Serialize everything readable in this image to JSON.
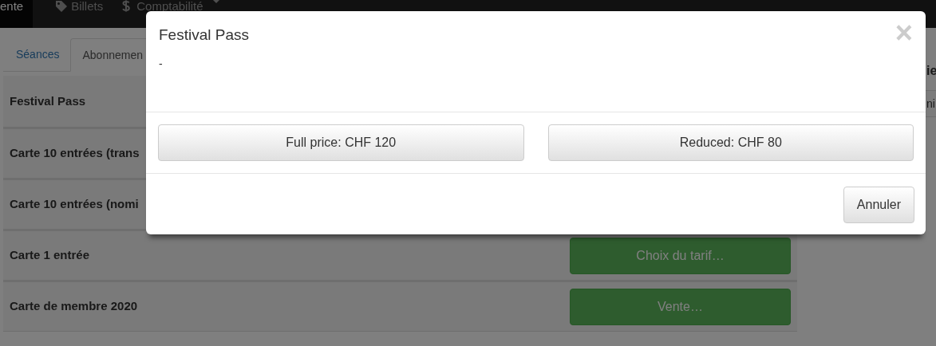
{
  "navbar": {
    "items": [
      {
        "label": "ente",
        "selected": true
      },
      {
        "label": "Billets",
        "selected": false
      },
      {
        "label": "Comptabilité",
        "selected": false
      }
    ]
  },
  "tabs": [
    {
      "label": "Séances",
      "selected": false
    },
    {
      "label": "Abonnemen",
      "selected": true
    }
  ],
  "products": [
    {
      "name": "Festival Pass"
    },
    {
      "name": "Carte 10 entrées (trans"
    },
    {
      "name": "Carte 10 entrées (nomi"
    },
    {
      "name": "Carte 1 entrée",
      "action": "Choix du tarif…"
    },
    {
      "name": "Carte de membre 2020",
      "action": "Vente…"
    }
  ],
  "side_panel": {
    "heading": "ie",
    "row": "ni"
  },
  "modal": {
    "title": "Festival Pass",
    "body": "-",
    "close": "×",
    "prices": [
      "Full price: CHF 120",
      "Reduced: CHF 80"
    ],
    "cancel": "Annuler"
  }
}
